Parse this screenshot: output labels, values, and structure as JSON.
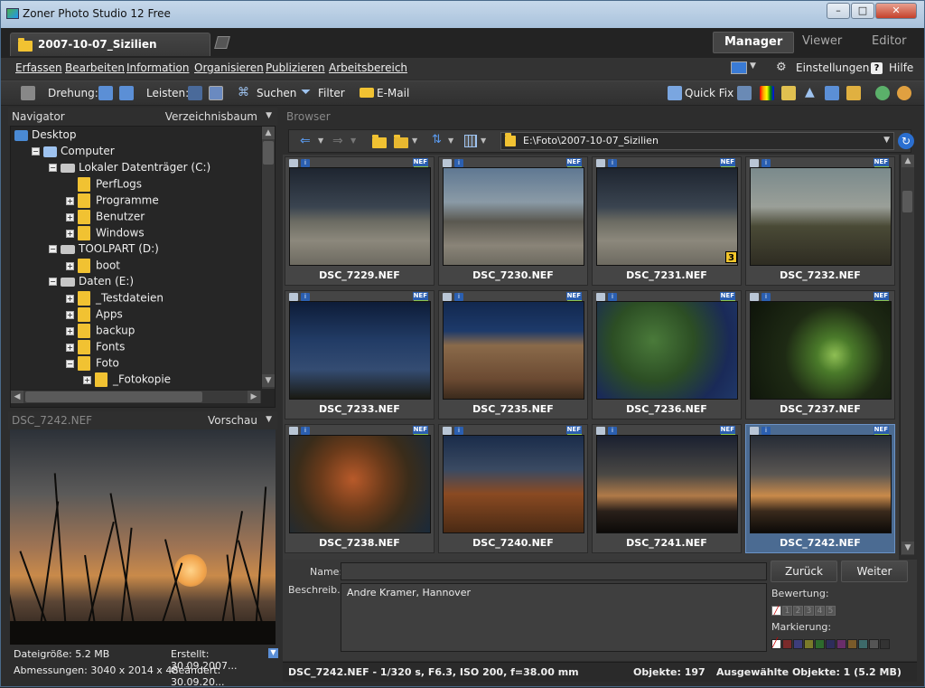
{
  "window": {
    "title": "Zoner Photo Studio 12 Free",
    "min": "–",
    "max": "□",
    "close": "✕"
  },
  "doc_tab": "2007-10-07_Sizilien",
  "modes": [
    "Manager",
    "Viewer",
    "Editor"
  ],
  "menu": [
    "Erfassen",
    "Bearbeiten",
    "Information",
    "Organisieren",
    "Publizieren",
    "Arbeitsbereich"
  ],
  "menu_right": {
    "settings": "Einstellungen",
    "help": "Hilfe"
  },
  "toolbar": {
    "rotation": "Drehung:",
    "bars": "Leisten:",
    "search": "Suchen",
    "filter": "Filter",
    "email": "E-Mail",
    "quickfix": "Quick Fix"
  },
  "navigator": {
    "title": "Navigator",
    "view": "Verzeichnisbaum"
  },
  "tree": [
    {
      "label": "Desktop",
      "level": 0,
      "exp": "",
      "icon": "desktop"
    },
    {
      "label": "Computer",
      "level": 1,
      "exp": "−",
      "icon": "computer"
    },
    {
      "label": "Lokaler Datenträger (C:)",
      "level": 2,
      "exp": "−",
      "icon": "drive"
    },
    {
      "label": "PerfLogs",
      "level": 3,
      "exp": "",
      "icon": "folder"
    },
    {
      "label": "Programme",
      "level": 3,
      "exp": "+",
      "icon": "folder"
    },
    {
      "label": "Benutzer",
      "level": 3,
      "exp": "+",
      "icon": "folder"
    },
    {
      "label": "Windows",
      "level": 3,
      "exp": "+",
      "icon": "folder"
    },
    {
      "label": "TOOLPART (D:)",
      "level": 2,
      "exp": "−",
      "icon": "drive"
    },
    {
      "label": "boot",
      "level": 3,
      "exp": "+",
      "icon": "folder"
    },
    {
      "label": "Daten (E:)",
      "level": 2,
      "exp": "−",
      "icon": "drive"
    },
    {
      "label": "_Testdateien",
      "level": 3,
      "exp": "+",
      "icon": "folder"
    },
    {
      "label": "Apps",
      "level": 3,
      "exp": "+",
      "icon": "folder"
    },
    {
      "label": "backup",
      "level": 3,
      "exp": "+",
      "icon": "folder"
    },
    {
      "label": "Fonts",
      "level": 3,
      "exp": "+",
      "icon": "folder"
    },
    {
      "label": "Foto",
      "level": 3,
      "exp": "−",
      "icon": "folder"
    },
    {
      "label": "_Fotokopie",
      "level": 4,
      "exp": "+",
      "icon": "folder"
    }
  ],
  "preview": {
    "filename": "DSC_7242.NEF",
    "mode": "Vorschau"
  },
  "fileinfo": {
    "size": "Dateigröße: 5.2 MB",
    "created": "Erstellt: 30.09.2007...",
    "dims": "Abmessungen: 3040 x 2014 x 48",
    "modified": "Geändert: 30.09.20..."
  },
  "browser": {
    "title": "Browser",
    "path": "E:\\Foto\\2007-10-07_Sizilien"
  },
  "thumbs": [
    {
      "name": "DSC_7229.NEF",
      "scene": "sheep",
      "stack": ""
    },
    {
      "name": "DSC_7230.NEF",
      "scene": "sheep2",
      "stack": ""
    },
    {
      "name": "DSC_7231.NEF",
      "scene": "sheep",
      "stack": "3"
    },
    {
      "name": "DSC_7232.NEF",
      "scene": "field",
      "stack": ""
    },
    {
      "name": "DSC_7233.NEF",
      "scene": "tower",
      "stack": ""
    },
    {
      "name": "DSC_7235.NEF",
      "scene": "house",
      "stack": ""
    },
    {
      "name": "DSC_7236.NEF",
      "scene": "tree",
      "stack": ""
    },
    {
      "name": "DSC_7237.NEF",
      "scene": "fruit",
      "stack": ""
    },
    {
      "name": "DSC_7238.NEF",
      "scene": "vine",
      "stack": ""
    },
    {
      "name": "DSC_7240.NEF",
      "scene": "vine2",
      "stack": ""
    },
    {
      "name": "DSC_7241.NEF",
      "scene": "sunset",
      "stack": ""
    },
    {
      "name": "DSC_7242.NEF",
      "scene": "sunset2",
      "stack": "",
      "selected": true
    }
  ],
  "nef_label": "NEF",
  "form": {
    "name_label": "Name:",
    "desc_label": "Beschreib.:",
    "desc_value": "Andre Kramer, Hannover",
    "back": "Zurück",
    "next": "Weiter",
    "rating_label": "Bewertung:",
    "ratings": [
      "1",
      "2",
      "3",
      "4",
      "5"
    ],
    "marking_label": "Markierung:"
  },
  "mark_colors": [
    "#7a2a2a",
    "#3d3d7a",
    "#7a7a2a",
    "#2d6a2d",
    "#2d2d5a",
    "#6a2d6a",
    "#7a5a2a",
    "#3d6a6a",
    "#555555",
    "#333333"
  ],
  "status": {
    "exif": "DSC_7242.NEF - 1/320 s, F6.3, ISO 200, f=38.00 mm",
    "objects": "Objekte: 197",
    "selected": "Ausgewählte Objekte: 1 (5.2 MB)"
  }
}
